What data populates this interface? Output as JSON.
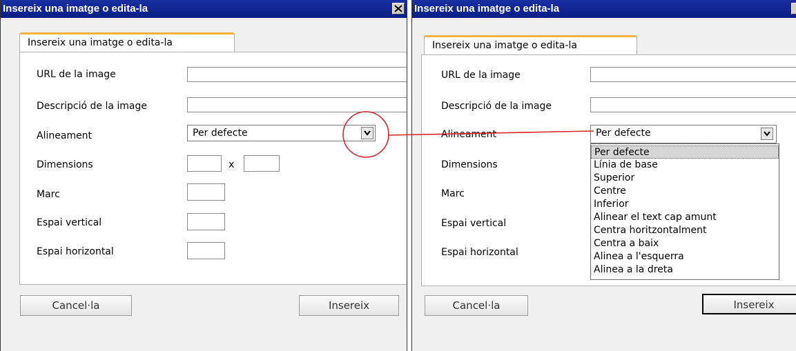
{
  "left_dialog": {
    "title": "Insereix una imatge o edita-la",
    "close_label": "✕",
    "tab_label": "Insereix una imatge o edita-la",
    "fields": {
      "url_label": "URL de la image",
      "description_label": "Descripció de la image",
      "alignment_label": "Alineament",
      "alignment_value": "Per defecte",
      "dimensions_label": "Dimensions",
      "dimensions_separator": "x",
      "border_label": "Marc",
      "vspace_label": "Espai vertical",
      "hspace_label": "Espai horizontal"
    },
    "cancel_label": "Cancel·la",
    "insert_label": "Insereix"
  },
  "right_dialog": {
    "title": "Insereix una imatge o edita-la",
    "tab_label": "Insereix una imatge o edita-la",
    "fields": {
      "url_label": "URL de la image",
      "description_label": "Descripció de la image",
      "alignment_label": "Alineament",
      "alignment_value": "Per defecte",
      "dimensions_label": "Dimensions",
      "border_label": "Marc",
      "vspace_label": "Espai vertical",
      "hspace_label": "Espai horizontal"
    },
    "dropdown_options": [
      "Per defecte",
      "Línia de base",
      "Superior",
      "Centre",
      "Inferior",
      "Alinear el text cap amunt",
      "Centra horitzontalment",
      "Centra a baix",
      "Alinea a l'esquerra",
      "Alinea a la dreta"
    ],
    "selected_option_index": 0,
    "cancel_label": "Cancel·la",
    "insert_label": "Insereix"
  },
  "annotation_color": "#d9262b",
  "title_bar_color": "#0a1e86",
  "tab_accent_color": "#f4b23c"
}
